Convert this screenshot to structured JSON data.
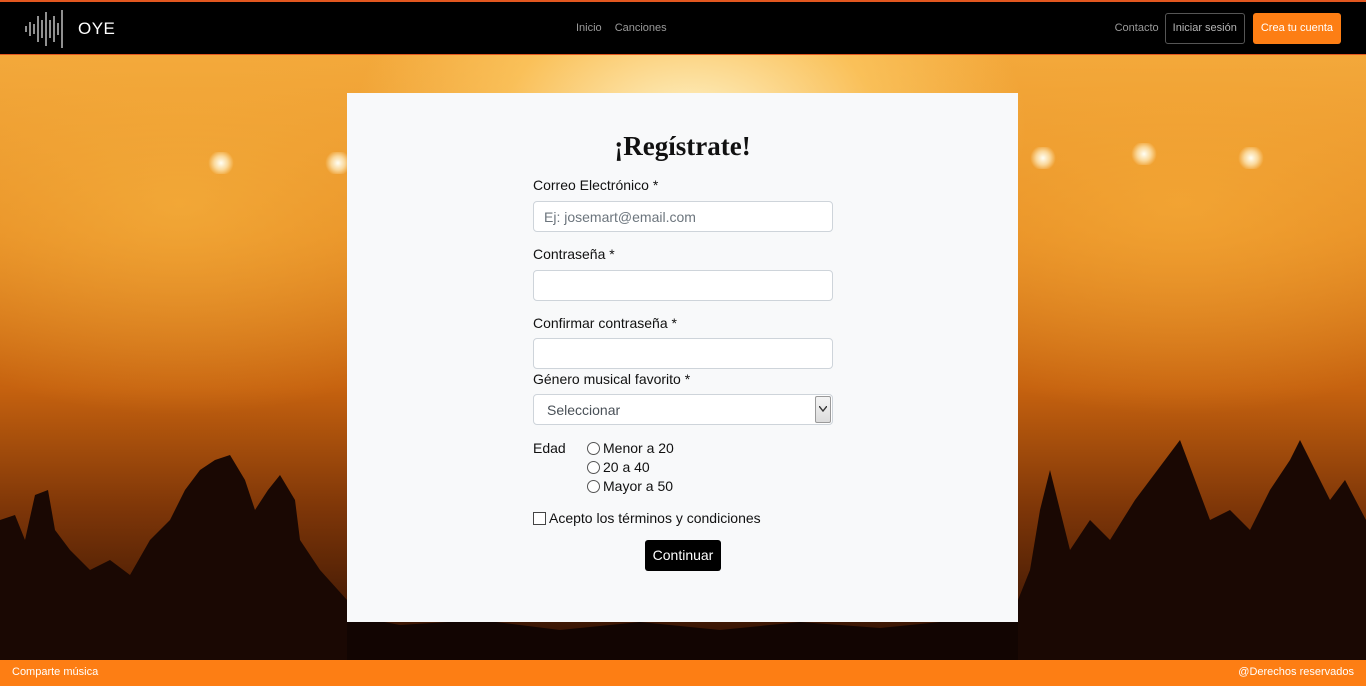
{
  "navbar": {
    "brand": "OYE",
    "logo_icon": "sound-wave-icon",
    "links": [
      "Inicio",
      "Canciones"
    ],
    "contact": "Contacto",
    "login": "Iniciar sesión",
    "signup": "Crea tu cuenta",
    "accent_color": "#fd7e14"
  },
  "form": {
    "title": "¡Regístrate!",
    "email": {
      "label": "Correo Electrónico *",
      "placeholder": "Ej: josemart@email.com",
      "value": ""
    },
    "password": {
      "label": "Contraseña *",
      "value": ""
    },
    "confirm": {
      "label": "Confirmar contraseña *",
      "value": ""
    },
    "genre": {
      "label": "Género musical favorito *",
      "selected": "Seleccionar"
    },
    "age": {
      "label": "Edad",
      "options": [
        "Menor a 20",
        "20 a 40",
        "Mayor a 50"
      ]
    },
    "terms": "Acepto los términos y condiciones",
    "submit": "Continuar"
  },
  "footer": {
    "left": "Comparte música",
    "right": "@Derechos reservados"
  }
}
